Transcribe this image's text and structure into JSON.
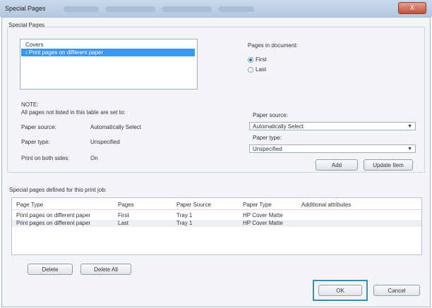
{
  "window": {
    "title": "Special Pages",
    "close_label": "X"
  },
  "special_pages": {
    "group_label": "Special Pages",
    "list_items": [
      "Covers",
      "Print pages on different paper"
    ],
    "selected_index": 1
  },
  "pages_in_document": {
    "label": "Pages in document:",
    "options": [
      "First",
      "Last"
    ],
    "selected": "First"
  },
  "note": {
    "title": "NOTE:",
    "text": "All pages not listed in this table are set to:",
    "rows": [
      {
        "label": "Paper source:",
        "value": "Automatically Select"
      },
      {
        "label": "Paper type:",
        "value": "Unspecified"
      },
      {
        "label": "Print on both sides:",
        "value": "On"
      }
    ]
  },
  "paper_source": {
    "label": "Paper source:",
    "value": "Automatically Select"
  },
  "paper_type": {
    "label": "Paper type:",
    "value": "Unspecified"
  },
  "buttons": {
    "add": "Add",
    "update_item": "Update Item",
    "delete": "Delete",
    "delete_all": "Delete All",
    "ok": "OK",
    "cancel": "Cancel"
  },
  "defined_pages": {
    "label": "Special pages defined for this print job:",
    "columns": [
      "Page Type",
      "Pages",
      "Paper Source",
      "Paper Type",
      "Additional attributes"
    ],
    "rows": [
      [
        "Print pages on different paper",
        "First",
        "Tray 1",
        "HP Cover Matte",
        ""
      ],
      [
        "Print pages on different paper",
        "Last",
        "Tray 1",
        "HP Cover Matte",
        ""
      ]
    ]
  }
}
